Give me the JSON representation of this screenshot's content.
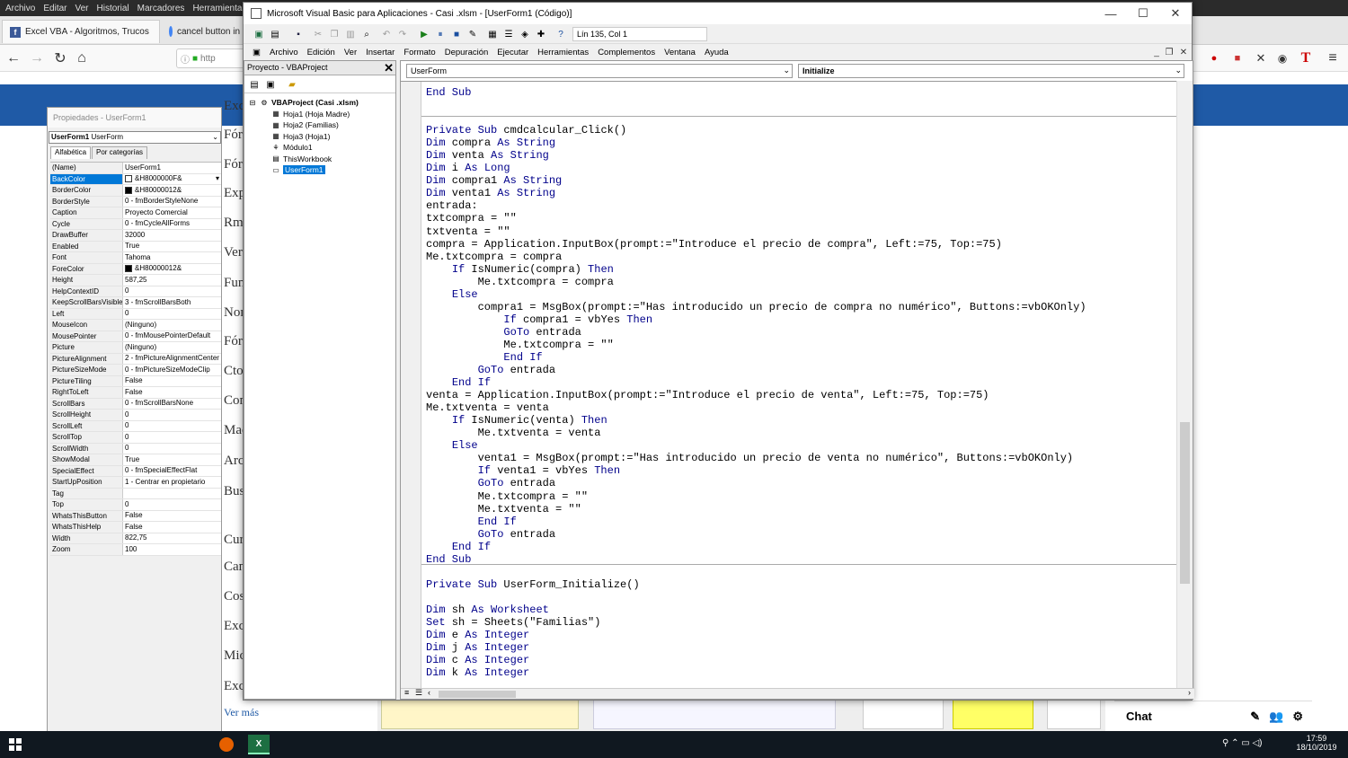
{
  "browser": {
    "menu": [
      "Archivo",
      "Editar",
      "Ver",
      "Historial",
      "Marcadores",
      "Herramientas"
    ],
    "tabs": [
      {
        "label": "Excel VBA - Algoritmos, Trucos"
      },
      {
        "label": "cancel button in"
      }
    ],
    "url": "http"
  },
  "page": {
    "side_words": [
      "Excel",
      "Fórm",
      "Fórm",
      "Expo",
      "Rma",
      "Ver",
      "Funci",
      "Nombr",
      "Fórmulas",
      "Ctos",
      "Contos",
      "Macros",
      "Archivo",
      "Buscar",
      "Cursos",
      "Cancelar",
      "Costos",
      "Excel",
      "Micro",
      "Excel",
      "Ver más"
    ],
    "chat_label": "Chat"
  },
  "props": {
    "title": "Propiedades - UserForm1",
    "object_name": "UserForm1",
    "object_type": "UserForm",
    "tab_alpha": "Alfabética",
    "tab_cat": "Por categorías",
    "rows": [
      {
        "n": "(Name)",
        "v": "UserForm1"
      },
      {
        "n": "BackColor",
        "v": "&H8000000F&",
        "sw": "#ffffff",
        "sel": true
      },
      {
        "n": "BorderColor",
        "v": "&H80000012&",
        "sw": "#000000"
      },
      {
        "n": "BorderStyle",
        "v": "0 - fmBorderStyleNone"
      },
      {
        "n": "Caption",
        "v": "Proyecto Comercial"
      },
      {
        "n": "Cycle",
        "v": "0 - fmCycleAllForms"
      },
      {
        "n": "DrawBuffer",
        "v": "32000"
      },
      {
        "n": "Enabled",
        "v": "True"
      },
      {
        "n": "Font",
        "v": "Tahoma"
      },
      {
        "n": "ForeColor",
        "v": "&H80000012&",
        "sw": "#000000"
      },
      {
        "n": "Height",
        "v": "587,25"
      },
      {
        "n": "HelpContextID",
        "v": "0"
      },
      {
        "n": "KeepScrollBarsVisible",
        "v": "3 - fmScrollBarsBoth"
      },
      {
        "n": "Left",
        "v": "0"
      },
      {
        "n": "MouseIcon",
        "v": "(Ninguno)"
      },
      {
        "n": "MousePointer",
        "v": "0 - fmMousePointerDefault"
      },
      {
        "n": "Picture",
        "v": "(Ninguno)"
      },
      {
        "n": "PictureAlignment",
        "v": "2 - fmPictureAlignmentCenter"
      },
      {
        "n": "PictureSizeMode",
        "v": "0 - fmPictureSizeModeClip"
      },
      {
        "n": "PictureTiling",
        "v": "False"
      },
      {
        "n": "RightToLeft",
        "v": "False"
      },
      {
        "n": "ScrollBars",
        "v": "0 - fmScrollBarsNone"
      },
      {
        "n": "ScrollHeight",
        "v": "0"
      },
      {
        "n": "ScrollLeft",
        "v": "0"
      },
      {
        "n": "ScrollTop",
        "v": "0"
      },
      {
        "n": "ScrollWidth",
        "v": "0"
      },
      {
        "n": "ShowModal",
        "v": "True"
      },
      {
        "n": "SpecialEffect",
        "v": "0 - fmSpecialEffectFlat"
      },
      {
        "n": "StartUpPosition",
        "v": "1 - Centrar en propietario"
      },
      {
        "n": "Tag",
        "v": ""
      },
      {
        "n": "Top",
        "v": "0"
      },
      {
        "n": "WhatsThisButton",
        "v": "False"
      },
      {
        "n": "WhatsThisHelp",
        "v": "False"
      },
      {
        "n": "Width",
        "v": "822,75"
      },
      {
        "n": "Zoom",
        "v": "100"
      }
    ]
  },
  "vba": {
    "title": "Microsoft Visual Basic para Aplicaciones - Casi .xlsm - [UserForm1 (Código)]",
    "position": "Lín 135, Col 1",
    "menu": [
      "Archivo",
      "Edición",
      "Ver",
      "Insertar",
      "Formato",
      "Depuración",
      "Ejecutar",
      "Herramientas",
      "Complementos",
      "Ventana",
      "Ayuda"
    ],
    "project_title": "Proyecto - VBAProject",
    "tree": [
      {
        "label": "VBAProject (Casi .xlsm)",
        "icon": "project-icon",
        "lvl": 0,
        "bold": true
      },
      {
        "label": "Hoja1 (Hoja Madre)",
        "icon": "sheet-icon",
        "lvl": 1
      },
      {
        "label": "Hoja2 (Familias)",
        "icon": "sheet-icon",
        "lvl": 1
      },
      {
        "label": "Hoja3 (Hoja1)",
        "icon": "sheet-icon",
        "lvl": 1
      },
      {
        "label": "Módulo1",
        "icon": "module-icon",
        "lvl": 1
      },
      {
        "label": "ThisWorkbook",
        "icon": "workbook-icon",
        "lvl": 1
      },
      {
        "label": "UserForm1",
        "icon": "form-icon",
        "lvl": 1,
        "sel": true
      }
    ],
    "object_combo": "UserForm",
    "proc_combo": "Initialize",
    "code": [
      "End Sub",
      "",
      "",
      "Private Sub cmdcalcular_Click()",
      "Dim compra As String",
      "Dim venta As String",
      "Dim i As Long",
      "Dim compra1 As String",
      "Dim venta1 As String",
      "entrada:",
      "txtcompra = \"\"",
      "txtventa = \"\"",
      "compra = Application.InputBox(prompt:=\"Introduce el precio de compra\", Left:=75, Top:=75)",
      "Me.txtcompra = compra",
      "    If IsNumeric(compra) Then",
      "        Me.txtcompra = compra",
      "    Else",
      "        compra1 = MsgBox(prompt:=\"Has introducido un precio de compra no numérico\", Buttons:=vbOKOnly)",
      "            If compra1 = vbYes Then",
      "            GoTo entrada",
      "            Me.txtcompra = \"\"",
      "            End If",
      "        GoTo entrada",
      "    End If",
      "venta = Application.InputBox(prompt:=\"Introduce el precio de venta\", Left:=75, Top:=75)",
      "Me.txtventa = venta",
      "    If IsNumeric(venta) Then",
      "        Me.txtventa = venta",
      "    Else",
      "        venta1 = MsgBox(prompt:=\"Has introducido un precio de venta no numérico\", Buttons:=vbOKOnly)",
      "        If venta1 = vbYes Then",
      "        GoTo entrada",
      "        Me.txtcompra = \"\"",
      "        Me.txtventa = \"\"",
      "        End If",
      "        GoTo entrada",
      "    End If",
      "End Sub",
      "",
      "Private Sub UserForm_Initialize()",
      "",
      "Dim sh As Worksheet",
      "Set sh = Sheets(\"Familias\")",
      "Dim e As Integer",
      "Dim j As Integer",
      "Dim c As Integer",
      "Dim k As Integer"
    ]
  },
  "taskbar": {
    "time": "17:59",
    "date": "18/10/2019"
  }
}
